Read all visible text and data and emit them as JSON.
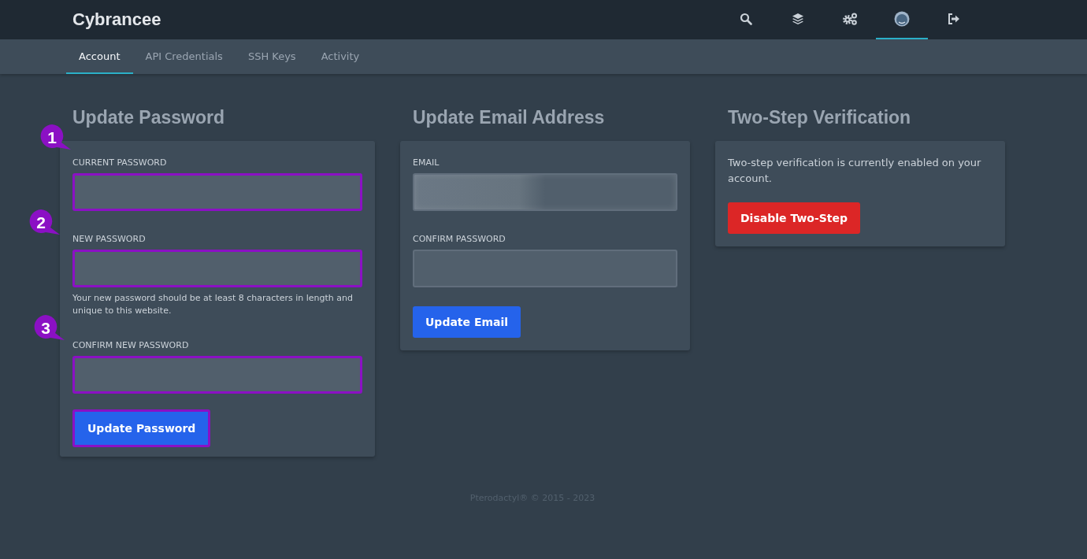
{
  "header": {
    "brand": "Cybrancee",
    "icons": [
      {
        "kind": "search",
        "selected": false
      },
      {
        "kind": "layers",
        "selected": false
      },
      {
        "kind": "gears",
        "selected": false
      },
      {
        "kind": "avatar",
        "selected": true
      },
      {
        "kind": "logout",
        "selected": false
      }
    ]
  },
  "tabs": [
    {
      "label": "Account",
      "selected": true
    },
    {
      "label": "API Credentials",
      "selected": false
    },
    {
      "label": "SSH Keys",
      "selected": false
    },
    {
      "label": "Activity",
      "selected": false
    }
  ],
  "password_section": {
    "title": "Update Password",
    "fields": [
      {
        "label": "CURRENT PASSWORD",
        "highlighted": true,
        "callout": "1"
      },
      {
        "label": "NEW PASSWORD",
        "highlighted": true,
        "callout": "2",
        "help": "Your new password should be at least 8 characters in length and unique to this website."
      },
      {
        "label": "CONFIRM NEW PASSWORD",
        "highlighted": true,
        "callout": "3"
      }
    ],
    "button": {
      "label": "Update Password",
      "highlighted": true
    }
  },
  "email_section": {
    "title": "Update Email Address",
    "fields": [
      {
        "label": "EMAIL",
        "redacted": true
      },
      {
        "label": "CONFIRM PASSWORD",
        "redacted": false
      }
    ],
    "button": {
      "label": "Update Email"
    }
  },
  "two_step_section": {
    "title": "Two-Step Verification",
    "text": "Two-step verification is currently enabled on your account.",
    "button": {
      "label": "Disable Two-Step"
    }
  },
  "footer": "Pterodactyl® © 2015 - 2023"
}
